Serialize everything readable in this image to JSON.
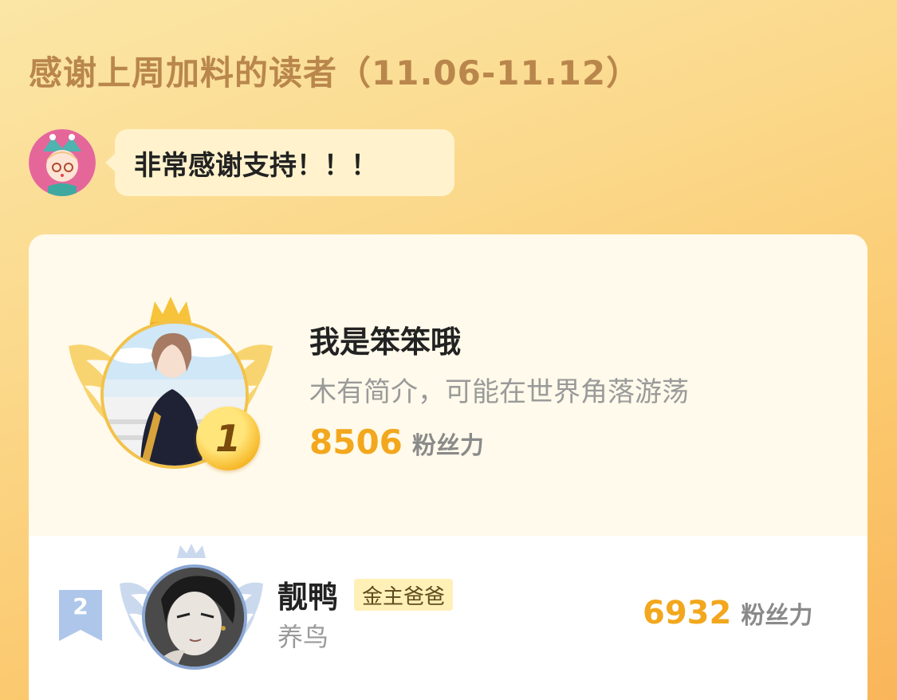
{
  "header": {
    "title": "感谢上周加料的读者（11.06-11.12）"
  },
  "author_message": {
    "text": "非常感谢支持！！！"
  },
  "ranking": [
    {
      "rank": "1",
      "name": "我是笨笨哦",
      "bio": "木有简介，可能在世界角落游荡",
      "score": "8506",
      "unit": "粉丝力"
    },
    {
      "rank": "2",
      "name": "靓鸭",
      "tag": "金主爸爸",
      "bio": "养鸟",
      "score": "6932",
      "unit": "粉丝力"
    }
  ],
  "colors": {
    "title": "#b9864c",
    "score": "#f2a71d",
    "gold": "#f3c24a",
    "silver": "#8aa6d1"
  },
  "icons": {
    "crown": "crown-icon",
    "wings": "wings-icon",
    "rank_medal": "medal-icon",
    "rank_ribbon": "ribbon-icon"
  }
}
